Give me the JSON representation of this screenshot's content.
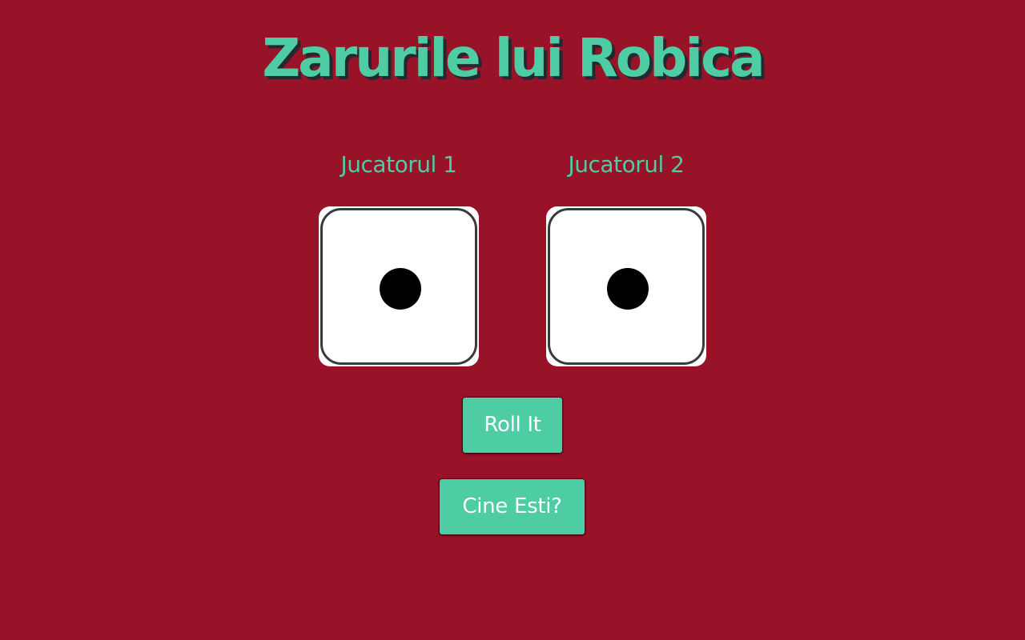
{
  "title": "Zarurile lui Robica",
  "colors": {
    "background": "#981327",
    "accent": "#4ecca3",
    "title_shadow": "#232931",
    "die_face": "#ffffff",
    "pip": "#000000"
  },
  "players": [
    {
      "name": "Jucatorul 1",
      "die_value": 1
    },
    {
      "name": "Jucatorul 2",
      "die_value": 1
    }
  ],
  "buttons": {
    "roll_label": "Roll It",
    "who_label": "Cine Esti?"
  }
}
